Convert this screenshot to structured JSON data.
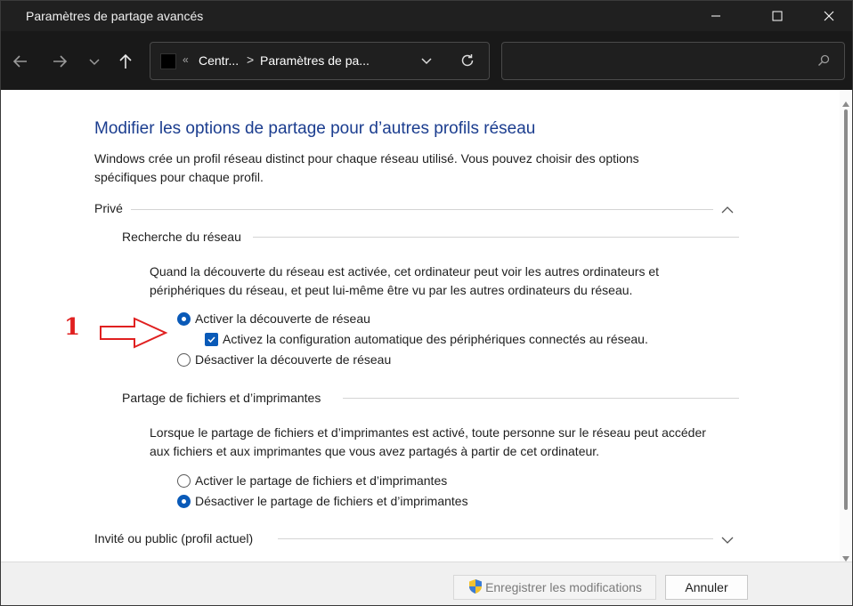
{
  "window": {
    "title": "Paramètres de partage avancés"
  },
  "address_bar": {
    "crumb_overflow": "«",
    "crumb1": "Centr...",
    "separator": ">",
    "crumb2": "Paramètres de pa..."
  },
  "search": {
    "placeholder": ""
  },
  "content": {
    "heading": "Modifier les options de partage pour d’autres profils réseau",
    "intro": "Windows crée un profil réseau distinct pour chaque réseau utilisé. Vous pouvez choisir des options spécifiques pour chaque profil.",
    "profile_private": {
      "label": "Privé",
      "network_discovery": {
        "label": "Recherche du réseau",
        "description": "Quand la découverte du réseau est activée, cet ordinateur peut voir les autres ordinateurs et périphériques du réseau, et peut lui-même être vu par les autres ordinateurs du réseau.",
        "option_on": "Activer la découverte de réseau",
        "option_auto": "Activez la configuration automatique des périphériques connectés au réseau.",
        "option_off": "Désactiver la découverte de réseau"
      },
      "file_sharing": {
        "label": "Partage de fichiers et d’imprimantes",
        "description": "Lorsque le partage de fichiers et d’imprimantes est activé, toute personne sur le réseau peut accéder aux fichiers et aux imprimantes que vous avez partagés à partir de cet ordinateur.",
        "option_on": "Activer le partage de fichiers et d’imprimantes",
        "option_off": "Désactiver le partage de fichiers et d’imprimantes"
      }
    },
    "profile_public": {
      "label": "Invité ou public (profil actuel)"
    }
  },
  "annotation": {
    "number": "1",
    "color": "#e02020"
  },
  "footer": {
    "save_label": "Enregistrer les modifications",
    "cancel_label": "Annuler"
  },
  "colors": {
    "heading": "#1b3d8f",
    "accent": "#0a5ab8",
    "titlebar": "#202020"
  }
}
